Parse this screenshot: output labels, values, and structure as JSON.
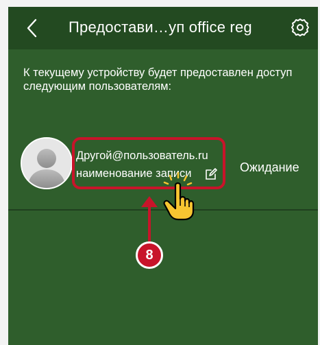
{
  "header": {
    "title": "Предостави…уп office reg",
    "back_icon": "chevron-left-icon",
    "settings_icon": "gear-icon"
  },
  "info_text": "К текущему устройству будет предоставлен доступ следующим пользователям:",
  "user": {
    "email": "Другой@пользователь.ru",
    "record_name": "наименование записи",
    "status": "Ожидание",
    "avatar_icon": "user-avatar-icon",
    "edit_icon": "edit-icon"
  },
  "annotation": {
    "step": "8"
  },
  "colors": {
    "background": "#2f5e2c",
    "appbar": "#234a21",
    "text": "#ffffff",
    "highlight": "#c8142a",
    "cursor_fill": "#f7c531"
  }
}
